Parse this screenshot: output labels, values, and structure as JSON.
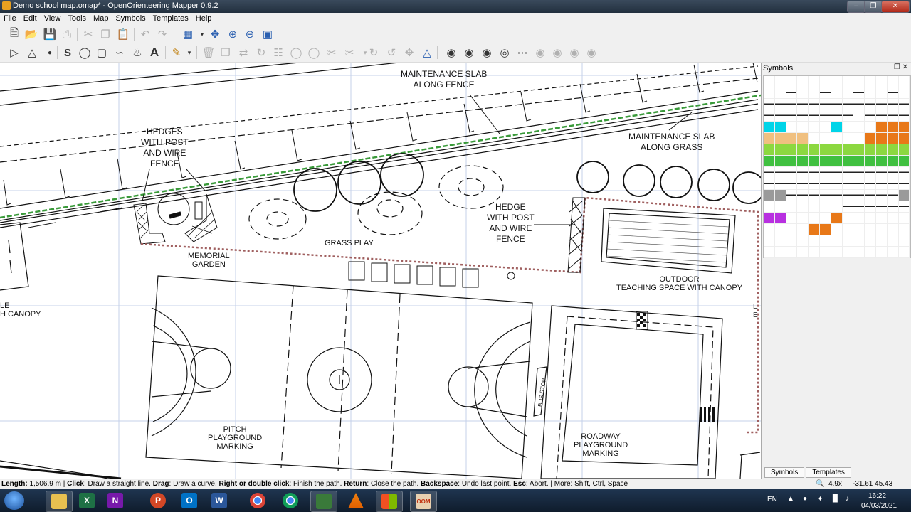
{
  "window": {
    "title": "Demo school map.omap* - OpenOrienteering Mapper 0.9.2"
  },
  "menu": [
    "File",
    "Edit",
    "View",
    "Tools",
    "Map",
    "Symbols",
    "Templates",
    "Help"
  ],
  "map_labels": {
    "maint_fence": [
      "MAINTENANCE SLAB",
      "ALONG FENCE"
    ],
    "maint_grass": [
      "MAINTENANCE SLAB",
      "ALONG GRASS"
    ],
    "hedges": [
      "HEDGES",
      "WITH POST",
      "AND WIRE",
      "FENCE"
    ],
    "hedge": [
      "HEDGE",
      "WITH POST",
      "AND WIRE",
      "FENCE"
    ],
    "memorial": [
      "MEMORIAL",
      "GARDEN"
    ],
    "grass_play": "GRASS PLAY",
    "outdoor": [
      "OUTDOOR",
      "TEACHING SPACE WITH CANOPY"
    ],
    "canopy_left": [
      "LE",
      "H CANOPY"
    ],
    "pitch": [
      "PITCH",
      "PLAYGROUND",
      "MARKING"
    ],
    "roadway": [
      "ROADWAY",
      "PLAYGROUND",
      "MARKING"
    ],
    "bus_stop": "BUS STOP",
    "edge_e": [
      "E",
      "E"
    ]
  },
  "symbols_panel": {
    "title": "Symbols",
    "tabs": [
      "Symbols",
      "Templates"
    ]
  },
  "symbol_colors": [
    "#000000",
    "#00d4e8",
    "#e87818",
    "#f0c080",
    "#8cd840",
    "#ffffff",
    "#40e8e8",
    "#9a9a9a",
    "#d0a040",
    "#40c040",
    "#b830e0",
    "#a0b830",
    "#f07090",
    "#4c4c4c",
    "#ff60ff"
  ],
  "status": {
    "length_label": "Length:",
    "length_value": "1,506.9 m",
    "sep1": "|",
    "click_key": "Click",
    "click_text": ": Draw a straight line.",
    "drag_key": "Drag",
    "drag_text": ": Draw a curve.",
    "right_key": "Right or double click",
    "right_text": ": Finish the path.",
    "return_key": "Return",
    "return_text": ": Close the path.",
    "backspace_key": "Backspace",
    "backspace_text": ": Undo last point.",
    "esc_key": "Esc",
    "esc_text": ": Abort. | More: Shift, Ctrl, Space",
    "zoom": "4.9x",
    "coords": "-31.61 45.43 (mm)"
  },
  "taskbar": {
    "apps": [
      "Explorer",
      "Excel",
      "OneNote",
      "PowerPoint",
      "Outlook",
      "Word",
      "Chrome",
      "Chrome",
      "Mapper",
      "VLC",
      "Windows Store",
      "OpenOrienteering Mapper"
    ],
    "lang": "EN",
    "time": "16:22",
    "date": "04/03/2021"
  }
}
